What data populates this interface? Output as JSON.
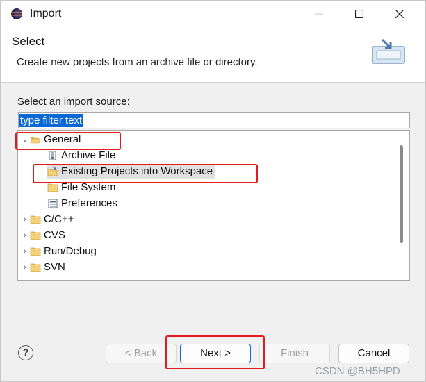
{
  "window": {
    "title": "Import",
    "minimize_label": "—",
    "maximize_label": "☐",
    "close_label": "✕"
  },
  "header": {
    "title": "Select",
    "description": "Create new projects from an archive file or directory."
  },
  "source": {
    "label": "Select an import source:",
    "filter_value": "type filter text"
  },
  "tree": {
    "items": [
      {
        "label": "General",
        "expanded": true,
        "level": 0,
        "icon": "folder-open-icon"
      },
      {
        "label": "Archive File",
        "level": 1,
        "icon": "archive-file-icon"
      },
      {
        "label": "Existing Projects into Workspace",
        "level": 1,
        "icon": "existing-project-icon",
        "selected": true
      },
      {
        "label": "File System",
        "level": 1,
        "icon": "folder-icon"
      },
      {
        "label": "Preferences",
        "level": 1,
        "icon": "preferences-icon"
      },
      {
        "label": "C/C++",
        "expanded": false,
        "level": 0,
        "icon": "folder-icon"
      },
      {
        "label": "CVS",
        "expanded": false,
        "level": 0,
        "icon": "folder-icon"
      },
      {
        "label": "Run/Debug",
        "expanded": false,
        "level": 0,
        "icon": "folder-icon"
      },
      {
        "label": "SVN",
        "expanded": false,
        "level": 0,
        "icon": "folder-icon"
      }
    ]
  },
  "footer": {
    "help_label": "?",
    "back_label": "< Back",
    "next_label": "Next >",
    "finish_label": "Finish",
    "cancel_label": "Cancel"
  },
  "watermark": "CSDN @BH5HPD",
  "colors": {
    "selection_blue": "#0a67d6",
    "highlight_red": "#e31b1b",
    "primary_border": "#1a68c7"
  }
}
